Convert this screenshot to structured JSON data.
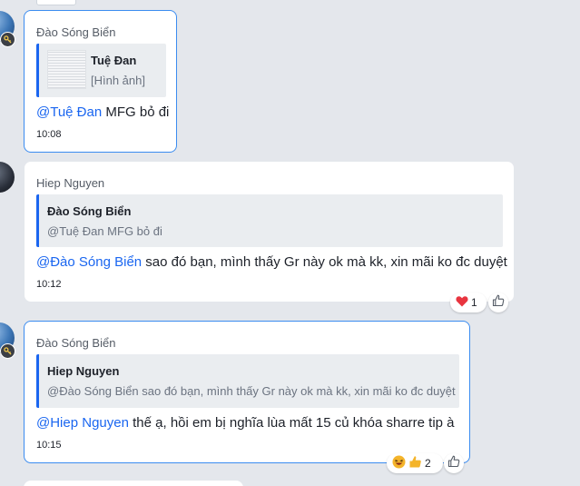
{
  "messages": [
    {
      "sender": "Đào Sóng Biển",
      "quote_name": "Tuệ Đan",
      "quote_text": "[Hình ảnh]",
      "mention": "@Tuệ Đan",
      "text": " MFG bỏ đi",
      "time": "10:08"
    },
    {
      "sender": "Hiep Nguyen",
      "quote_name": "Đào Sóng Biển",
      "quote_text": "@Tuệ Đan MFG bỏ đi",
      "mention": "@Đào Sóng Biển",
      "text": " sao đó bạn, mình thấy Gr này ok mà kk, xin mãi ko đc duyệt",
      "time": "10:12",
      "reaction_count": "1"
    },
    {
      "sender": "Đào Sóng Biển",
      "quote_name": "Hiep Nguyen",
      "quote_text": "@Đào Sóng Biển sao đó bạn, mình thấy Gr này ok mà kk, xin mãi ko đc duyệt",
      "mention": "@Hiep Nguyen",
      "text": " thế ạ, hồi em bị nghĩa  lùa mất 15 củ khóa sharre tip à",
      "time": "10:15",
      "reaction_count": "2"
    }
  ],
  "colors": {
    "accent": "#1a66f0",
    "own_border": "#3b8cf0",
    "background": "#e4e7ec",
    "heart": "#e8343f"
  }
}
